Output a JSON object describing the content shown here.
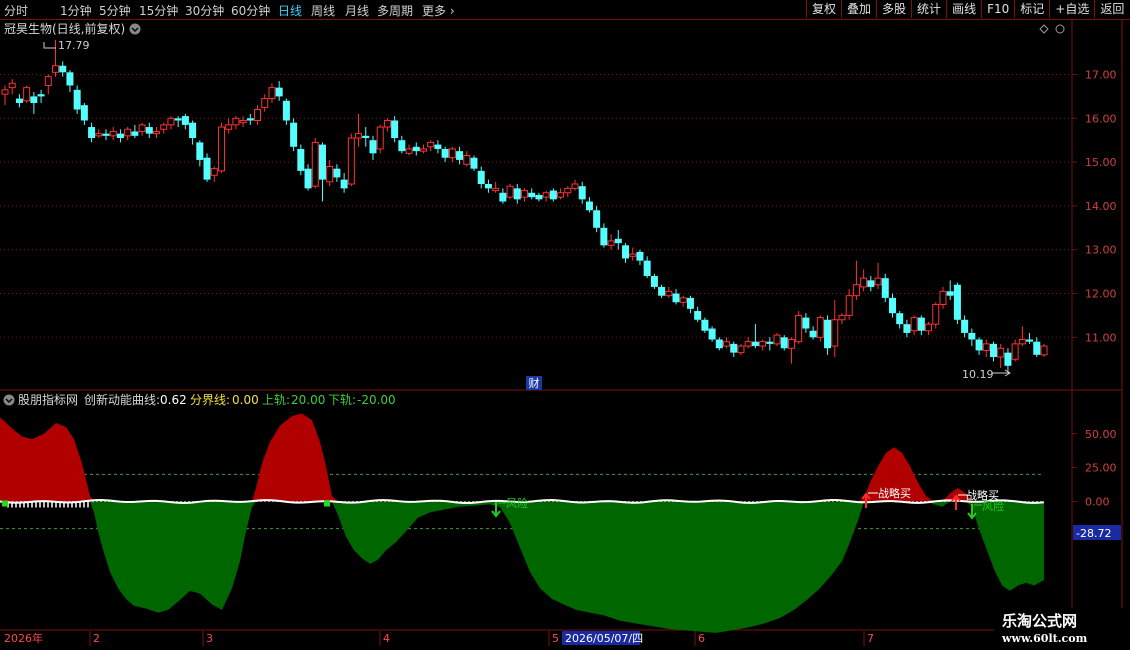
{
  "toolbar": {
    "periods": [
      "分时",
      "1分钟",
      "5分钟",
      "15分钟",
      "30分钟",
      "60分钟",
      "日线",
      "周线",
      "月线",
      "多周期",
      "更多"
    ],
    "active_period": "日线",
    "buttons": [
      "复权",
      "叠加",
      "多股",
      "统计",
      "画线",
      "F10",
      "标记",
      "+自选",
      "返回"
    ]
  },
  "main_chart": {
    "title": "冠昊生物(日线,前复权)",
    "high_label": "17.79",
    "low_label": "10.19",
    "finance_badge": "财",
    "y_ticks": [
      "17.00",
      "16.00",
      "15.00",
      "14.00",
      "13.00",
      "12.00",
      "11.00"
    ]
  },
  "indicator": {
    "name": "股朋指标网",
    "line_name": "创新动能曲线:",
    "line_value": "0.62",
    "divider_name": "分界线:",
    "divider_value": "0.00",
    "upper_name": "上轨:",
    "upper_value": "20.00",
    "lower_name": "下轨:",
    "lower_value": "-20.00",
    "y_ticks": [
      "50.00",
      "25.00",
      "0.00"
    ],
    "current_value": "-28.72",
    "signals": [
      {
        "text": "战略买",
        "color": "#ffffff"
      },
      {
        "text": "战略买",
        "color": "#ffffff"
      },
      {
        "text": "风险",
        "color": "#22cc22"
      },
      {
        "text": "风险",
        "color": "#22cc22"
      }
    ]
  },
  "x_axis": {
    "labels": [
      "2026年",
      "2",
      "3",
      "4",
      "5",
      "6",
      "7"
    ],
    "cursor_date": "2026/05/07/四"
  },
  "watermark": {
    "line1": "乐淘公式网",
    "line2": "www.60lt.com"
  },
  "colors": {
    "up": "#ff3232",
    "down": "#54ffff",
    "grid_red": "#7a1010",
    "fill_red": "#b00000",
    "fill_green": "#006600",
    "band": "#3c9c3c"
  },
  "chart_data": {
    "type": "candlestick",
    "price_range": [
      10.19,
      17.79
    ],
    "candles": [
      [
        16.55,
        16.65,
        16.75,
        16.3
      ],
      [
        16.7,
        16.8,
        16.9,
        16.55
      ],
      [
        16.45,
        16.35,
        16.55,
        16.25
      ],
      [
        16.4,
        16.7,
        16.75,
        16.35
      ],
      [
        16.5,
        16.35,
        16.6,
        16.1
      ],
      [
        16.55,
        16.5,
        16.65,
        16.35
      ],
      [
        16.75,
        16.95,
        17.0,
        16.55
      ],
      [
        17.05,
        17.2,
        17.79,
        16.95
      ],
      [
        17.2,
        17.05,
        17.3,
        16.95
      ],
      [
        17.05,
        16.75,
        17.1,
        16.6
      ],
      [
        16.65,
        16.2,
        16.75,
        16.1
      ],
      [
        16.3,
        15.95,
        16.35,
        15.85
      ],
      [
        15.8,
        15.55,
        15.9,
        15.45
      ],
      [
        15.6,
        15.65,
        15.75,
        15.55
      ],
      [
        15.65,
        15.6,
        15.75,
        15.5
      ],
      [
        15.6,
        15.7,
        15.8,
        15.5
      ],
      [
        15.65,
        15.55,
        15.75,
        15.45
      ],
      [
        15.6,
        15.75,
        15.8,
        15.5
      ],
      [
        15.7,
        15.6,
        15.85,
        15.55
      ],
      [
        15.7,
        15.85,
        15.9,
        15.6
      ],
      [
        15.8,
        15.65,
        15.9,
        15.55
      ],
      [
        15.65,
        15.7,
        15.8,
        15.55
      ],
      [
        15.75,
        15.85,
        15.9,
        15.65
      ],
      [
        15.85,
        16.0,
        16.05,
        15.75
      ],
      [
        16.0,
        15.95,
        16.05,
        15.8
      ],
      [
        16.05,
        15.85,
        16.1,
        15.75
      ],
      [
        15.9,
        15.55,
        15.95,
        15.4
      ],
      [
        15.45,
        15.05,
        15.5,
        14.9
      ],
      [
        15.1,
        14.6,
        15.2,
        14.55
      ],
      [
        14.7,
        14.85,
        14.9,
        14.55
      ],
      [
        14.8,
        15.8,
        15.9,
        14.75
      ],
      [
        15.75,
        15.85,
        16.0,
        15.65
      ],
      [
        15.85,
        16.0,
        16.05,
        15.75
      ],
      [
        15.9,
        15.95,
        16.05,
        15.8
      ],
      [
        16.0,
        15.95,
        16.1,
        15.85
      ],
      [
        15.95,
        16.2,
        16.3,
        15.85
      ],
      [
        16.25,
        16.45,
        16.55,
        16.15
      ],
      [
        16.45,
        16.7,
        16.8,
        16.35
      ],
      [
        16.7,
        16.5,
        16.85,
        16.4
      ],
      [
        16.4,
        15.95,
        16.45,
        15.85
      ],
      [
        15.9,
        15.35,
        16.0,
        15.25
      ],
      [
        15.3,
        14.8,
        15.4,
        14.7
      ],
      [
        14.85,
        14.4,
        14.95,
        14.35
      ],
      [
        14.45,
        15.45,
        15.55,
        14.4
      ],
      [
        15.4,
        14.6,
        15.45,
        14.1
      ],
      [
        14.55,
        14.9,
        15.05,
        14.45
      ],
      [
        14.85,
        14.65,
        14.95,
        14.55
      ],
      [
        14.6,
        14.4,
        14.75,
        14.3
      ],
      [
        14.5,
        15.55,
        15.65,
        14.45
      ],
      [
        15.55,
        15.65,
        16.1,
        15.35
      ],
      [
        15.6,
        15.55,
        15.8,
        15.35
      ],
      [
        15.5,
        15.2,
        15.6,
        15.05
      ],
      [
        15.3,
        15.8,
        15.85,
        15.2
      ],
      [
        15.8,
        15.95,
        16.0,
        15.7
      ],
      [
        15.95,
        15.55,
        16.05,
        15.45
      ],
      [
        15.5,
        15.25,
        15.6,
        15.2
      ],
      [
        15.2,
        15.3,
        15.4,
        15.15
      ],
      [
        15.35,
        15.25,
        15.45,
        15.15
      ],
      [
        15.25,
        15.3,
        15.4,
        15.2
      ],
      [
        15.35,
        15.45,
        15.5,
        15.25
      ],
      [
        15.4,
        15.3,
        15.5,
        15.2
      ],
      [
        15.3,
        15.1,
        15.35,
        15.0
      ],
      [
        15.1,
        15.3,
        15.35,
        15.0
      ],
      [
        15.25,
        15.05,
        15.35,
        14.95
      ],
      [
        14.95,
        15.15,
        15.25,
        14.9
      ],
      [
        15.1,
        14.85,
        15.15,
        14.8
      ],
      [
        14.8,
        14.5,
        14.9,
        14.4
      ],
      [
        14.5,
        14.4,
        14.6,
        14.3
      ],
      [
        14.35,
        14.4,
        14.55,
        14.3
      ],
      [
        14.3,
        14.1,
        14.4,
        14.05
      ],
      [
        14.2,
        14.45,
        14.5,
        14.15
      ],
      [
        14.4,
        14.15,
        14.5,
        14.05
      ],
      [
        14.2,
        14.35,
        14.4,
        14.1
      ],
      [
        14.3,
        14.2,
        14.4,
        14.15
      ],
      [
        14.25,
        14.15,
        14.3,
        14.1
      ],
      [
        14.2,
        14.3,
        14.35,
        14.1
      ],
      [
        14.35,
        14.15,
        14.4,
        14.1
      ],
      [
        14.2,
        14.3,
        14.4,
        14.15
      ],
      [
        14.3,
        14.4,
        14.45,
        14.2
      ],
      [
        14.4,
        14.5,
        14.6,
        14.35
      ],
      [
        14.45,
        14.15,
        14.55,
        14.05
      ],
      [
        14.1,
        13.9,
        14.2,
        13.85
      ],
      [
        13.9,
        13.5,
        14.0,
        13.4
      ],
      [
        13.5,
        13.1,
        13.6,
        13.05
      ],
      [
        13.1,
        13.2,
        13.35,
        13.0
      ],
      [
        13.25,
        13.15,
        13.45,
        13.0
      ],
      [
        13.1,
        12.8,
        13.15,
        12.7
      ],
      [
        12.85,
        12.9,
        13.05,
        12.75
      ],
      [
        12.95,
        12.75,
        13.0,
        12.65
      ],
      [
        12.75,
        12.4,
        12.85,
        12.35
      ],
      [
        12.4,
        12.15,
        12.45,
        12.1
      ],
      [
        12.15,
        11.95,
        12.2,
        11.9
      ],
      [
        11.95,
        12.05,
        12.15,
        11.9
      ],
      [
        12.0,
        11.8,
        12.1,
        11.75
      ],
      [
        11.8,
        11.9,
        11.95,
        11.7
      ],
      [
        11.9,
        11.65,
        11.95,
        11.55
      ],
      [
        11.6,
        11.4,
        11.7,
        11.35
      ],
      [
        11.4,
        11.15,
        11.45,
        11.1
      ],
      [
        11.2,
        10.95,
        11.25,
        10.9
      ],
      [
        10.95,
        10.75,
        11.0,
        10.7
      ],
      [
        10.8,
        10.9,
        11.0,
        10.75
      ],
      [
        10.85,
        10.65,
        10.9,
        10.55
      ],
      [
        10.65,
        10.8,
        10.85,
        10.6
      ],
      [
        10.8,
        10.9,
        11.0,
        10.75
      ],
      [
        10.9,
        10.8,
        11.3,
        10.75
      ],
      [
        10.8,
        10.9,
        10.95,
        10.7
      ],
      [
        10.9,
        10.85,
        11.0,
        10.7
      ],
      [
        10.85,
        11.05,
        11.1,
        10.8
      ],
      [
        11.0,
        10.75,
        11.05,
        10.7
      ],
      [
        10.75,
        10.95,
        11.0,
        10.4
      ],
      [
        10.9,
        11.5,
        11.6,
        10.85
      ],
      [
        11.45,
        11.2,
        11.55,
        11.1
      ],
      [
        11.15,
        11.0,
        11.25,
        10.95
      ],
      [
        11.0,
        11.45,
        11.5,
        10.9
      ],
      [
        11.4,
        10.75,
        11.5,
        10.6
      ],
      [
        10.8,
        11.4,
        11.85,
        10.55
      ],
      [
        11.4,
        11.5,
        11.55,
        11.3
      ],
      [
        11.5,
        11.95,
        12.1,
        11.4
      ],
      [
        11.95,
        12.2,
        12.75,
        11.85
      ],
      [
        12.15,
        12.35,
        12.55,
        12.05
      ],
      [
        12.3,
        12.15,
        12.4,
        12.05
      ],
      [
        12.2,
        12.35,
        12.7,
        12.1
      ],
      [
        12.35,
        11.9,
        12.45,
        11.8
      ],
      [
        11.9,
        11.55,
        12.0,
        11.45
      ],
      [
        11.55,
        11.3,
        11.6,
        11.2
      ],
      [
        11.3,
        11.1,
        11.4,
        11.0
      ],
      [
        11.15,
        11.45,
        11.5,
        11.05
      ],
      [
        11.45,
        11.15,
        11.5,
        11.05
      ],
      [
        11.15,
        11.3,
        11.35,
        11.05
      ],
      [
        11.3,
        11.75,
        11.8,
        11.2
      ],
      [
        11.75,
        12.05,
        12.15,
        11.65
      ],
      [
        12.05,
        11.95,
        12.3,
        11.85
      ],
      [
        12.2,
        11.4,
        12.25,
        11.3
      ],
      [
        11.4,
        11.1,
        11.5,
        11.0
      ],
      [
        11.1,
        10.95,
        11.2,
        10.8
      ],
      [
        10.95,
        10.7,
        11.0,
        10.6
      ],
      [
        10.7,
        10.85,
        10.95,
        10.55
      ],
      [
        10.85,
        10.55,
        10.9,
        10.45
      ],
      [
        10.55,
        10.75,
        10.85,
        10.3
      ],
      [
        10.65,
        10.35,
        10.75,
        10.19
      ],
      [
        10.5,
        10.85,
        10.95,
        10.45
      ],
      [
        10.85,
        10.95,
        11.25,
        10.8
      ],
      [
        10.95,
        10.9,
        11.1,
        10.85
      ],
      [
        10.9,
        10.6,
        11.0,
        10.55
      ],
      [
        10.6,
        10.8,
        10.85,
        10.55
      ]
    ],
    "momentum_curve": [
      [
        0,
        62
      ],
      [
        12,
        54
      ],
      [
        22,
        48
      ],
      [
        32,
        46
      ],
      [
        44,
        50
      ],
      [
        56,
        58
      ],
      [
        66,
        55
      ],
      [
        74,
        46
      ],
      [
        82,
        28
      ],
      [
        90,
        4
      ],
      [
        94,
        -8
      ],
      [
        98,
        -22
      ],
      [
        104,
        -38
      ],
      [
        110,
        -52
      ],
      [
        118,
        -64
      ],
      [
        126,
        -72
      ],
      [
        134,
        -77
      ],
      [
        146,
        -79
      ],
      [
        158,
        -82
      ],
      [
        168,
        -80
      ],
      [
        178,
        -74
      ],
      [
        190,
        -66
      ],
      [
        200,
        -68
      ],
      [
        212,
        -76
      ],
      [
        222,
        -80
      ],
      [
        232,
        -64
      ],
      [
        240,
        -44
      ],
      [
        246,
        -22
      ],
      [
        252,
        -4
      ],
      [
        256,
        10
      ],
      [
        262,
        28
      ],
      [
        270,
        44
      ],
      [
        280,
        56
      ],
      [
        292,
        63
      ],
      [
        302,
        65
      ],
      [
        312,
        60
      ],
      [
        320,
        44
      ],
      [
        326,
        26
      ],
      [
        332,
        4
      ],
      [
        338,
        -10
      ],
      [
        346,
        -26
      ],
      [
        354,
        -36
      ],
      [
        362,
        -42
      ],
      [
        370,
        -46
      ],
      [
        378,
        -43
      ],
      [
        386,
        -36
      ],
      [
        396,
        -30
      ],
      [
        406,
        -22
      ],
      [
        418,
        -12
      ],
      [
        430,
        -8
      ],
      [
        444,
        -6
      ],
      [
        458,
        -4
      ],
      [
        474,
        -3
      ],
      [
        490,
        -2
      ],
      [
        500,
        -4
      ],
      [
        510,
        -16
      ],
      [
        520,
        -34
      ],
      [
        530,
        -52
      ],
      [
        540,
        -64
      ],
      [
        552,
        -72
      ],
      [
        564,
        -76
      ],
      [
        576,
        -80
      ],
      [
        590,
        -82
      ],
      [
        604,
        -84
      ],
      [
        620,
        -88
      ],
      [
        636,
        -90
      ],
      [
        652,
        -92
      ],
      [
        668,
        -94
      ],
      [
        684,
        -95
      ],
      [
        700,
        -96
      ],
      [
        716,
        -97
      ],
      [
        732,
        -95
      ],
      [
        748,
        -93
      ],
      [
        764,
        -90
      ],
      [
        780,
        -86
      ],
      [
        794,
        -80
      ],
      [
        808,
        -72
      ],
      [
        820,
        -64
      ],
      [
        832,
        -54
      ],
      [
        842,
        -44
      ],
      [
        850,
        -30
      ],
      [
        858,
        -14
      ],
      [
        864,
        2
      ],
      [
        870,
        14
      ],
      [
        878,
        26
      ],
      [
        886,
        36
      ],
      [
        894,
        40
      ],
      [
        902,
        36
      ],
      [
        910,
        26
      ],
      [
        918,
        14
      ],
      [
        926,
        4
      ],
      [
        934,
        -2
      ],
      [
        942,
        -4
      ],
      [
        950,
        6
      ],
      [
        958,
        10
      ],
      [
        966,
        6
      ],
      [
        972,
        -4
      ],
      [
        978,
        -18
      ],
      [
        986,
        -34
      ],
      [
        994,
        -50
      ],
      [
        1002,
        -62
      ],
      [
        1010,
        -66
      ],
      [
        1018,
        -62
      ],
      [
        1026,
        -60
      ],
      [
        1034,
        -62
      ],
      [
        1044,
        -58
      ]
    ]
  }
}
